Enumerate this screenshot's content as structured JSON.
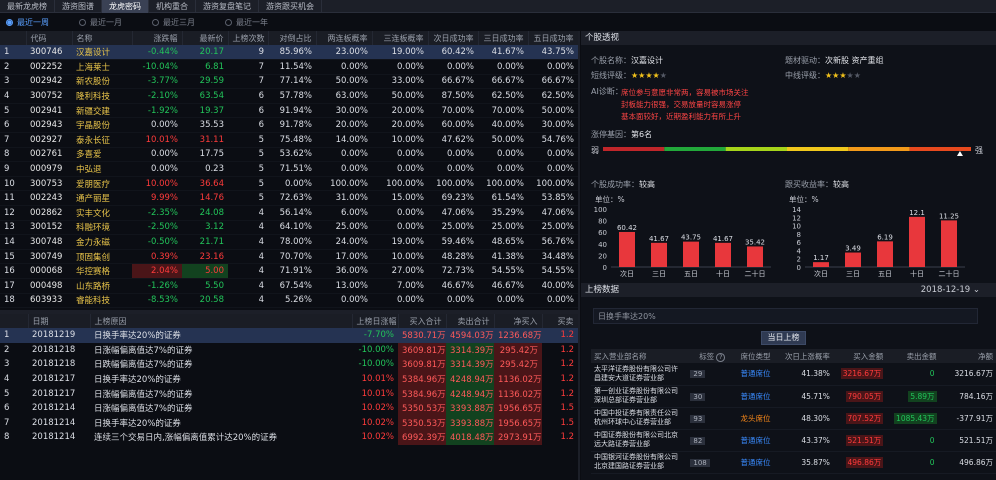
{
  "tabs": [
    {
      "label": "最新龙虎榜",
      "active": false
    },
    {
      "label": "游资图谱",
      "active": false
    },
    {
      "label": "龙虎密码",
      "active": true
    },
    {
      "label": "机构重合",
      "active": false
    },
    {
      "label": "游资复盘笔记",
      "active": false
    },
    {
      "label": "游资跟买机会",
      "active": false
    }
  ],
  "range_options": [
    {
      "label": "最近一周",
      "selected": true
    },
    {
      "label": "最近一月",
      "selected": false
    },
    {
      "label": "最近三月",
      "selected": false
    },
    {
      "label": "最近一年",
      "selected": false
    }
  ],
  "stock_table": {
    "headers": [
      "",
      "代码",
      "名称",
      "涨跌幅",
      "最新价",
      "上榜次数",
      "对倒占比",
      "两连板概率",
      "三连板概率",
      "次日成功率",
      "三日成功率",
      "五日成功率"
    ],
    "sort_indicator": "↓",
    "rows": [
      {
        "no": "1",
        "code": "300746",
        "name": "汉嘉设计",
        "chg": "-0.44%",
        "price": "20.17",
        "times": "9",
        "dui": "85.96%",
        "p2": "23.00%",
        "p3": "19.00%",
        "d1": "60.42%",
        "d3": "41.67%",
        "d5": "43.75%",
        "dir": "dn",
        "sel": true,
        "hl": ""
      },
      {
        "no": "2",
        "code": "002252",
        "name": "上海莱士",
        "chg": "-10.04%",
        "price": "6.81",
        "times": "7",
        "dui": "11.54%",
        "p2": "0.00%",
        "p3": "0.00%",
        "d1": "0.00%",
        "d3": "0.00%",
        "d5": "0.00%",
        "dir": "dn",
        "sel": false,
        "hl": ""
      },
      {
        "no": "3",
        "code": "002942",
        "name": "新农股份",
        "chg": "-3.77%",
        "price": "29.59",
        "times": "7",
        "dui": "77.14%",
        "p2": "50.00%",
        "p3": "33.00%",
        "d1": "66.67%",
        "d3": "66.67%",
        "d5": "66.67%",
        "dir": "dn",
        "sel": false,
        "hl": ""
      },
      {
        "no": "4",
        "code": "300752",
        "name": "隆利科技",
        "chg": "-2.10%",
        "price": "63.54",
        "times": "6",
        "dui": "57.78%",
        "p2": "63.00%",
        "p3": "50.00%",
        "d1": "87.50%",
        "d3": "62.50%",
        "d5": "62.50%",
        "dir": "dn",
        "sel": false,
        "hl": ""
      },
      {
        "no": "5",
        "code": "002941",
        "name": "新疆交建",
        "chg": "-1.92%",
        "price": "19.37",
        "times": "6",
        "dui": "91.94%",
        "p2": "30.00%",
        "p3": "20.00%",
        "d1": "70.00%",
        "d3": "70.00%",
        "d5": "50.00%",
        "dir": "dn",
        "sel": false,
        "hl": ""
      },
      {
        "no": "6",
        "code": "002943",
        "name": "宇晶股份",
        "chg": "0.00%",
        "price": "35.53",
        "times": "6",
        "dui": "91.78%",
        "p2": "20.00%",
        "p3": "20.00%",
        "d1": "60.00%",
        "d3": "40.00%",
        "d5": "30.00%",
        "dir": "wh",
        "sel": false,
        "hl": ""
      },
      {
        "no": "7",
        "code": "002927",
        "name": "泰永长征",
        "chg": "10.01%",
        "price": "31.11",
        "times": "5",
        "dui": "75.48%",
        "p2": "14.00%",
        "p3": "10.00%",
        "d1": "47.62%",
        "d3": "50.00%",
        "d5": "54.76%",
        "dir": "up",
        "sel": false,
        "hl": ""
      },
      {
        "no": "8",
        "code": "002761",
        "name": "多喜爱",
        "chg": "0.00%",
        "price": "17.75",
        "times": "5",
        "dui": "53.62%",
        "p2": "0.00%",
        "p3": "0.00%",
        "d1": "0.00%",
        "d3": "0.00%",
        "d5": "0.00%",
        "dir": "wh",
        "sel": false,
        "hl": ""
      },
      {
        "no": "9",
        "code": "000979",
        "name": "中弘退",
        "chg": "0.00%",
        "price": "0.23",
        "times": "5",
        "dui": "71.51%",
        "p2": "0.00%",
        "p3": "0.00%",
        "d1": "0.00%",
        "d3": "0.00%",
        "d5": "0.00%",
        "dir": "wh",
        "sel": false,
        "hl": ""
      },
      {
        "no": "10",
        "code": "300753",
        "name": "爱朋医疗",
        "chg": "10.00%",
        "price": "36.64",
        "times": "5",
        "dui": "0.00%",
        "p2": "100.00%",
        "p3": "100.00%",
        "d1": "100.00%",
        "d3": "100.00%",
        "d5": "100.00%",
        "dir": "up",
        "sel": false,
        "hl": ""
      },
      {
        "no": "11",
        "code": "002243",
        "name": "通产丽星",
        "chg": "9.99%",
        "price": "14.76",
        "times": "5",
        "dui": "72.63%",
        "p2": "31.00%",
        "p3": "15.00%",
        "d1": "69.23%",
        "d3": "61.54%",
        "d5": "53.85%",
        "dir": "up",
        "sel": false,
        "hl": ""
      },
      {
        "no": "12",
        "code": "002862",
        "name": "实丰文化",
        "chg": "-2.35%",
        "price": "24.08",
        "times": "4",
        "dui": "56.14%",
        "p2": "6.00%",
        "p3": "0.00%",
        "d1": "47.06%",
        "d3": "35.29%",
        "d5": "47.06%",
        "dir": "dn",
        "sel": false,
        "hl": ""
      },
      {
        "no": "13",
        "code": "300152",
        "name": "科融环境",
        "chg": "-2.50%",
        "price": "3.12",
        "times": "4",
        "dui": "64.10%",
        "p2": "25.00%",
        "p3": "0.00%",
        "d1": "25.00%",
        "d3": "25.00%",
        "d5": "25.00%",
        "dir": "dn",
        "sel": false,
        "hl": ""
      },
      {
        "no": "14",
        "code": "300748",
        "name": "金力永磁",
        "chg": "-0.50%",
        "price": "21.71",
        "times": "4",
        "dui": "78.00%",
        "p2": "24.00%",
        "p3": "19.00%",
        "d1": "59.46%",
        "d3": "48.65%",
        "d5": "56.76%",
        "dir": "dn",
        "sel": false,
        "hl": ""
      },
      {
        "no": "15",
        "code": "300749",
        "name": "顶固集创",
        "chg": "0.39%",
        "price": "23.16",
        "times": "4",
        "dui": "70.70%",
        "p2": "17.00%",
        "p3": "10.00%",
        "d1": "48.28%",
        "d3": "41.38%",
        "d5": "34.48%",
        "dir": "up",
        "sel": false,
        "hl": ""
      },
      {
        "no": "16",
        "code": "000068",
        "name": "华控赛格",
        "chg": "2.04%",
        "price": "5.00",
        "times": "4",
        "dui": "71.91%",
        "p2": "36.00%",
        "p3": "27.00%",
        "d1": "72.73%",
        "d3": "54.55%",
        "d5": "54.55%",
        "dir": "up",
        "sel": false,
        "hl": "chg-price"
      },
      {
        "no": "17",
        "code": "000498",
        "name": "山东路桥",
        "chg": "-1.26%",
        "price": "5.50",
        "times": "4",
        "dui": "67.54%",
        "p2": "13.00%",
        "p3": "7.00%",
        "d1": "46.67%",
        "d3": "46.67%",
        "d5": "40.00%",
        "dir": "dn",
        "sel": false,
        "hl": ""
      },
      {
        "no": "18",
        "code": "603933",
        "name": "睿能科技",
        "chg": "-8.53%",
        "price": "20.58",
        "times": "4",
        "dui": "5.26%",
        "p2": "0.00%",
        "p3": "0.00%",
        "d1": "0.00%",
        "d3": "0.00%",
        "d5": "0.00%",
        "dir": "dn",
        "sel": false,
        "hl": ""
      }
    ]
  },
  "record_table": {
    "headers": [
      "",
      "日期",
      "上榜原因",
      "上榜日涨幅",
      "买入合计",
      "卖出合计",
      "净买入",
      "买卖"
    ],
    "rows": [
      {
        "no": "1",
        "date": "20181219",
        "reason": "日换手率达20%的证券",
        "chg": "-7.70%",
        "buy": "5830.71万",
        "sell": "4594.03万",
        "net": "1236.68万",
        "bs": "1.2",
        "dir": "dn",
        "sel": true
      },
      {
        "no": "2",
        "date": "20181218",
        "reason": "日涨幅偏离值达7%的证券",
        "chg": "-10.00%",
        "buy": "3609.81万",
        "sell": "3314.39万",
        "net": "295.42万",
        "bs": "1.2",
        "dir": "dn",
        "sel": false
      },
      {
        "no": "3",
        "date": "20181218",
        "reason": "日跌幅偏离值达7%的证券",
        "chg": "-10.00%",
        "buy": "3609.81万",
        "sell": "3314.39万",
        "net": "295.42万",
        "bs": "1.2",
        "dir": "dn",
        "sel": false
      },
      {
        "no": "4",
        "date": "20181217",
        "reason": "日换手率达20%的证券",
        "chg": "10.01%",
        "buy": "5384.96万",
        "sell": "4248.94万",
        "net": "1136.02万",
        "bs": "1.2",
        "dir": "up",
        "sel": false
      },
      {
        "no": "5",
        "date": "20181217",
        "reason": "日涨幅偏离值达7%的证券",
        "chg": "10.01%",
        "buy": "5384.96万",
        "sell": "4248.94万",
        "net": "1136.02万",
        "bs": "1.2",
        "dir": "up",
        "sel": false
      },
      {
        "no": "6",
        "date": "20181214",
        "reason": "日涨幅偏离值达7%的证券",
        "chg": "10.02%",
        "buy": "5350.53万",
        "sell": "3393.88万",
        "net": "1956.65万",
        "bs": "1.5",
        "dir": "up",
        "sel": false
      },
      {
        "no": "7",
        "date": "20181214",
        "reason": "日换手率达20%的证券",
        "chg": "10.02%",
        "buy": "5350.53万",
        "sell": "3393.88万",
        "net": "1956.65万",
        "bs": "1.5",
        "dir": "up",
        "sel": false
      },
      {
        "no": "8",
        "date": "20181214",
        "reason": "连续三个交易日内,涨幅偏离值累计达20%的证券",
        "chg": "10.02%",
        "buy": "6992.39万",
        "sell": "4018.48万",
        "net": "2973.91万",
        "bs": "1.2",
        "dir": "up",
        "sel": false
      }
    ]
  },
  "diagnosis": {
    "header": "个股透视",
    "stock_label": "个股名称：",
    "stock_name": "汉嘉设计",
    "concept_label": "题材驱动：",
    "concept_value": "次新股  资产重组",
    "short_label": "短线评级：",
    "short_stars": 4,
    "mid_label": "中线评级：",
    "mid_stars": 3,
    "ai_label": "AI诊断：",
    "ai_lines": [
      "席位参与意愿非常两，容易被市场关注",
      "封板能力很强，交易放量时容易涨停",
      "基本面较好，近期盈利能力有所上升"
    ],
    "rank_label": "涨停基因：",
    "rank_value": "第6名",
    "gauge_left": "弱",
    "gauge_right": "强",
    "gauge_level": 0.97,
    "gauge_colors": [
      "#c0262a",
      "#22a83a",
      "#a6d41a",
      "#f0c81c",
      "#f29a1a",
      "#e84a1e"
    ]
  },
  "chart_data": [
    {
      "type": "bar",
      "title": "个股成功率：",
      "title_value": "较高",
      "ylabel": "单位：%",
      "categories": [
        "次日",
        "三日",
        "五日",
        "十日",
        "二十日"
      ],
      "values": [
        60.42,
        41.67,
        43.75,
        41.67,
        35.42
      ],
      "ylim": [
        0,
        100
      ],
      "yticks": [
        0,
        20,
        40,
        60,
        80,
        100
      ],
      "color": "#e8373c"
    },
    {
      "type": "bar",
      "title": "跟买收益率：",
      "title_value": "较高",
      "ylabel": "单位：%",
      "categories": [
        "次日",
        "三日",
        "五日",
        "十日",
        "二十日"
      ],
      "values": [
        1.17,
        3.49,
        6.19,
        12.1,
        11.25
      ],
      "ylim": [
        0,
        14
      ],
      "yticks": [
        0,
        2,
        4,
        6,
        8,
        10,
        12,
        14
      ],
      "color": "#e8373c"
    }
  ],
  "billboard": {
    "header": "上榜数据",
    "date": "2018-12-19",
    "reason": "日换手率达20%",
    "button": "当日上榜",
    "headers": [
      "买入营业部名称",
      "标签",
      "席位类型",
      "次日上涨概率",
      "买入金额",
      "卖出金额",
      "净额"
    ],
    "tag_icon": "?",
    "rows": [
      {
        "dept": "太平洋证券股份有限公司许昌建安大道证券营业部",
        "tag": "29",
        "type": "普通席位",
        "prob": "41.38%",
        "buy": "3216.67万",
        "sell": "0",
        "net": "3216.67万",
        "kind": "normal"
      },
      {
        "dept": "第一创业证券股份有限公司深圳总部证券营业部",
        "tag": "30",
        "type": "普通席位",
        "prob": "45.71%",
        "buy": "790.05万",
        "sell": "5.89万",
        "net": "784.16万",
        "kind": "normal"
      },
      {
        "dept": "中国中投证券有限责任公司杭州环球中心证券营业部",
        "tag": "93",
        "type": "龙头席位",
        "prob": "48.30%",
        "buy": "707.52万",
        "sell": "1085.43万",
        "net": "-377.91万",
        "kind": "tiger"
      },
      {
        "dept": "中国证券股份有限公司北京远大路证券营业部",
        "tag": "82",
        "type": "普通席位",
        "prob": "43.37%",
        "buy": "521.51万",
        "sell": "0",
        "net": "521.51万",
        "kind": "normal"
      },
      {
        "dept": "中国银河证券股份有限公司北京建国路证券营业部",
        "tag": "108",
        "type": "普通席位",
        "prob": "35.87%",
        "buy": "496.86万",
        "sell": "0",
        "net": "496.86万",
        "kind": "normal"
      }
    ]
  }
}
